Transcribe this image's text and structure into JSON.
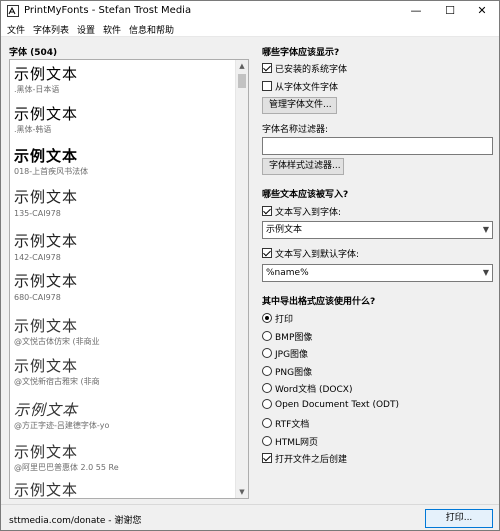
{
  "window": {
    "title": "PrintMyFonts - Stefan Trost Media",
    "controls": {
      "minimize": "—",
      "maximize": "☐",
      "close": "✕"
    }
  },
  "menu": [
    "文件",
    "字体列表",
    "设置",
    "软件",
    "信息和帮助"
  ],
  "font_list": {
    "header": "字体 (504)",
    "entries": [
      {
        "sample": "示例文本",
        "name": ".黑体-日本语"
      },
      {
        "sample": "示例文本",
        "name": ".黑体-韩语"
      },
      {
        "sample": "示例文本",
        "name": "018-上首疾风书法体"
      },
      {
        "sample": "示例文本",
        "name": "135-CAI978"
      },
      {
        "sample": "示例文本",
        "name": "142-CAI978"
      },
      {
        "sample": "示例文本",
        "name": "680-CAI978"
      },
      {
        "sample": "示例文本",
        "name": "@文悦古体仿宋 (非商业"
      },
      {
        "sample": "示例文本",
        "name": "@文悦新宿古雅宋 (非商"
      },
      {
        "sample": "示例文本",
        "name": "@方正字迹-吕建德字体-yo"
      },
      {
        "sample": "示例文本",
        "name": "@阿里巴巴普惠体 2.0 55 Re"
      },
      {
        "sample": "示例文本",
        "name": ""
      }
    ]
  },
  "display_section": {
    "title": "哪些字体应该显示?",
    "installed": {
      "label": "已安装的系统字体",
      "checked": true
    },
    "from_files": {
      "label": "从字体文件字体",
      "checked": false
    },
    "manage_button": "管理字体文件..."
  },
  "filter": {
    "name_label": "字体名称过滤器:",
    "name_value": "",
    "style_button": "字体样式过滤器..."
  },
  "write_section": {
    "title": "哪些文本应该被写入?",
    "write_to_font": {
      "label": "文本写入到字体:",
      "checked": true,
      "value": "示例文本"
    },
    "write_default": {
      "label": "文本写入到默认字体:",
      "checked": true,
      "value": "%name%"
    }
  },
  "export_section": {
    "title": "其中导出格式应该使用什么?",
    "options": [
      {
        "label": "打印",
        "checked": true
      },
      {
        "label": "BMP图像",
        "checked": false
      },
      {
        "label": "JPG图像",
        "checked": false
      },
      {
        "label": "PNG图像",
        "checked": false
      },
      {
        "label": "Word文档 (DOCX)",
        "checked": false
      },
      {
        "label": "Open Document Text (ODT)",
        "checked": false
      },
      {
        "label": "RTF文档",
        "checked": false
      },
      {
        "label": "HTML网页",
        "checked": false
      }
    ],
    "open_after": {
      "label": "打开文件之后创建",
      "checked": true
    }
  },
  "status": {
    "text": "sttmedia.com/donate - 谢谢您",
    "print_button": "打印..."
  },
  "colors": {
    "accent": "#0078d7"
  }
}
